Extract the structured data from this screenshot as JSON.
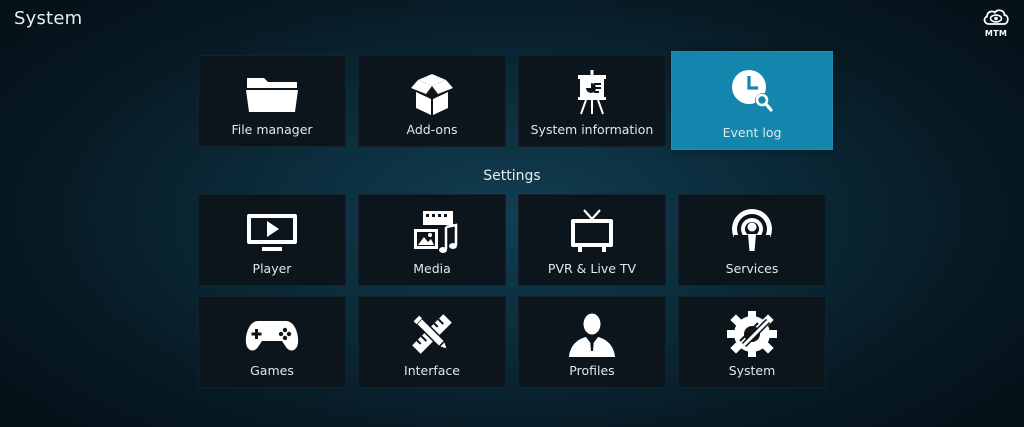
{
  "header": {
    "title": "System"
  },
  "logo": {
    "label": "MTM",
    "icon": "eye-cloud-icon"
  },
  "top_row": [
    {
      "label": "File manager",
      "icon": "folder-icon"
    },
    {
      "label": "Add-ons",
      "icon": "open-box-icon"
    },
    {
      "label": "System information",
      "icon": "presentation-easel-icon"
    },
    {
      "label": "Event log",
      "icon": "clock-search-icon",
      "focused": true
    }
  ],
  "settings_header": "Settings",
  "settings_row1": [
    {
      "label": "Player",
      "icon": "monitor-play-icon"
    },
    {
      "label": "Media",
      "icon": "media-film-photo-music-icon"
    },
    {
      "label": "PVR & Live TV",
      "icon": "tv-antenna-icon"
    },
    {
      "label": "Services",
      "icon": "podcast-broadcast-icon"
    }
  ],
  "settings_row2": [
    {
      "label": "Games",
      "icon": "gamepad-icon"
    },
    {
      "label": "Interface",
      "icon": "pencil-ruler-icon"
    },
    {
      "label": "Profiles",
      "icon": "person-profile-icon"
    },
    {
      "label": "System",
      "icon": "gear-wrench-icon"
    }
  ],
  "colors": {
    "focus": "#1386ad",
    "tile": "#0b151b",
    "text": "#e2e8ec"
  }
}
